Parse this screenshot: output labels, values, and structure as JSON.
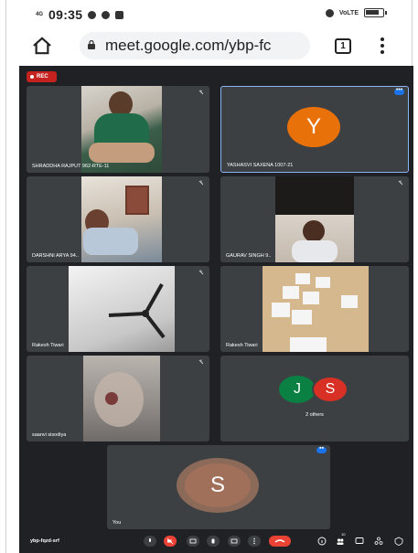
{
  "status_bar": {
    "network": "4G",
    "time": "09:35",
    "lte": "VoLTE",
    "battery": "84"
  },
  "browser": {
    "url": "meet.google.com/ybp-fc",
    "tab_count": "1"
  },
  "meet": {
    "rec_label": "REC",
    "tiles": [
      {
        "name": "SHRADDHA RAJPUT 962-RTE-11"
      },
      {
        "name": "YASHASVI SAXENA 1007-21",
        "initial": "Y",
        "color": "#e8710a"
      },
      {
        "name": "DARSHNI ARYA 94.."
      },
      {
        "name": "GAURAV SINGH 9.."
      },
      {
        "name": "Rakesh Tiwari"
      },
      {
        "name": "Rakesh Tiwari"
      },
      {
        "name": "saanvi sisodiya"
      },
      {
        "name": "2 others",
        "initials": [
          "J",
          "S"
        ],
        "colors": [
          "#0b8043",
          "#d93025"
        ]
      }
    ],
    "self_tile": {
      "name": "You",
      "initial": "S",
      "color": "#a1705a"
    },
    "meeting_code": "ybp-fqzd-srf",
    "participant_count": "10"
  },
  "colors": {
    "meet_bg": "#202124",
    "tile_bg": "#3c4043",
    "accent_blue": "#8ab4f8",
    "end_red": "#ea4335"
  }
}
